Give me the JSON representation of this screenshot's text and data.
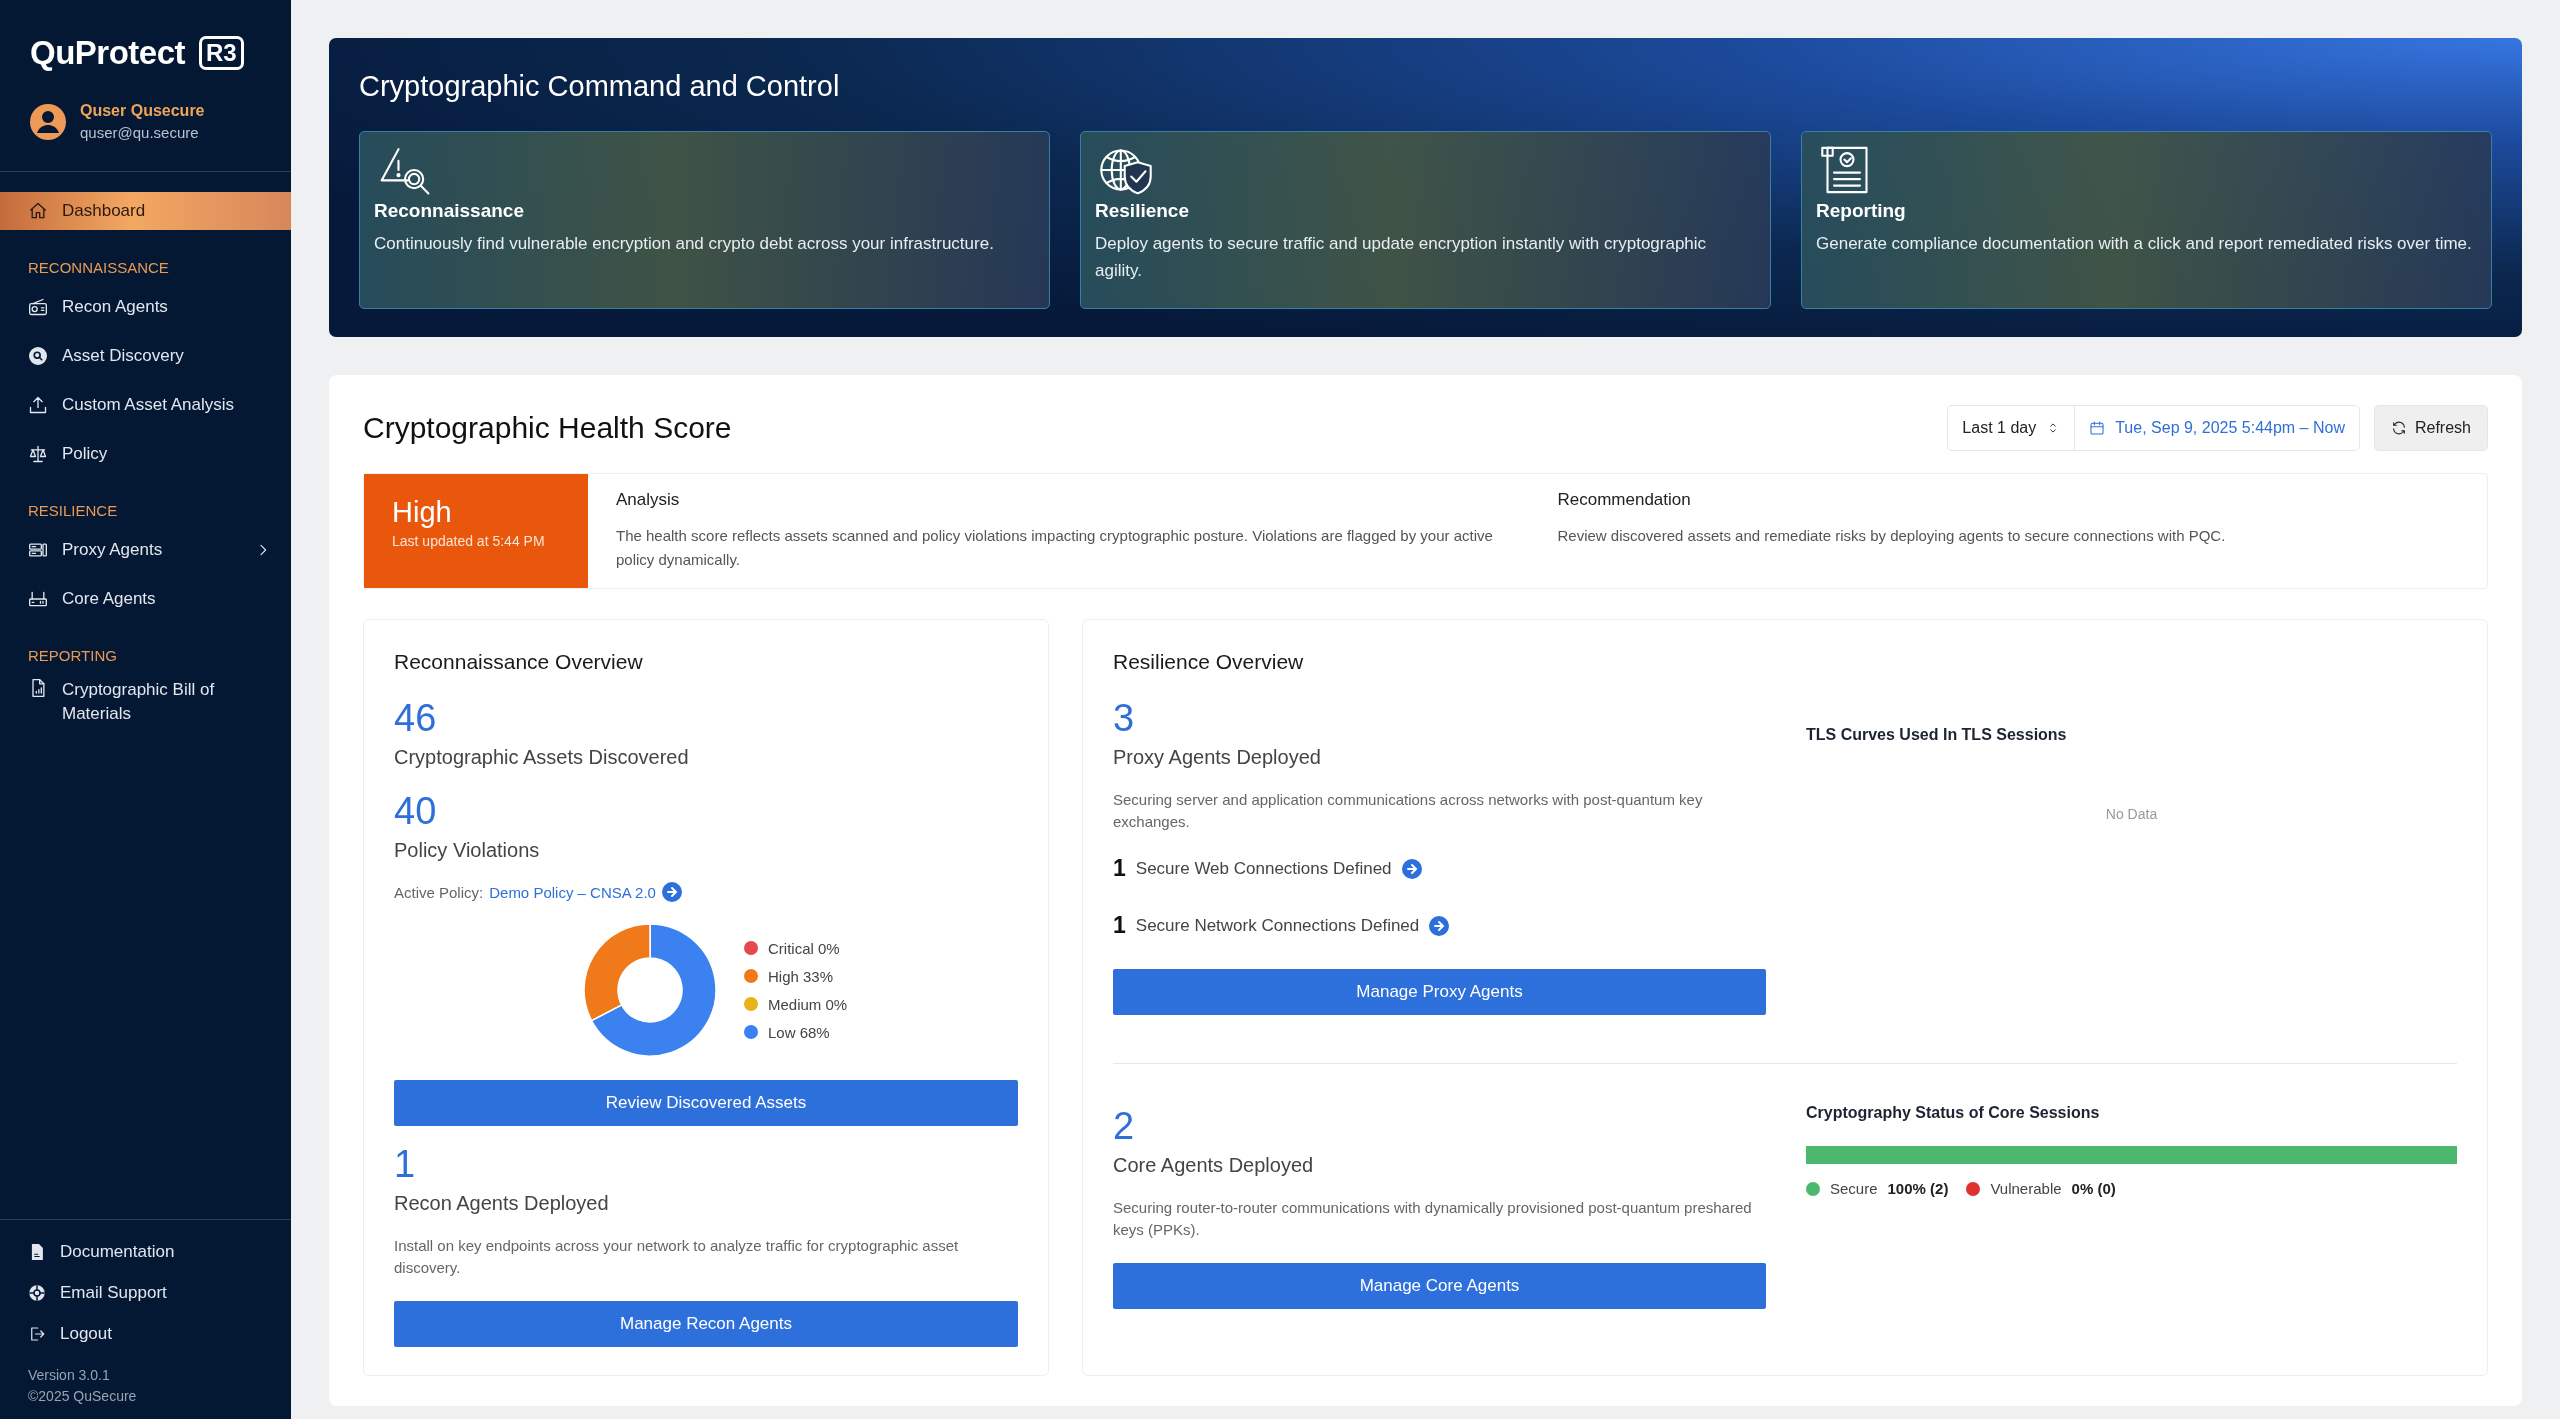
{
  "sidebar": {
    "logo": "QuProtect",
    "logo_mark": "R3",
    "user": {
      "name": "Quser Qusecure",
      "email": "quser@qu.secure"
    },
    "sections": [
      {
        "items": [
          {
            "label": "Dashboard",
            "selected": true,
            "has_submenu": false
          }
        ]
      },
      {
        "heading": "RECONNAISSANCE",
        "items": [
          {
            "label": "Recon Agents",
            "selected": false,
            "has_submenu": false
          },
          {
            "label": "Asset Discovery",
            "selected": false,
            "has_submenu": false
          },
          {
            "label": "Custom Asset Analysis",
            "selected": false,
            "has_submenu": false
          },
          {
            "label": "Policy",
            "selected": false,
            "has_submenu": false
          }
        ]
      },
      {
        "heading": "RESILIENCE",
        "items": [
          {
            "label": "Proxy Agents",
            "selected": false,
            "has_submenu": true
          },
          {
            "label": "Core Agents",
            "selected": false,
            "has_submenu": false
          }
        ]
      },
      {
        "heading": "REPORTING",
        "items": [
          {
            "label": "Cryptographic Bill of Materials",
            "selected": false,
            "has_submenu": false
          }
        ]
      }
    ],
    "footer_links": [
      "Documentation",
      "Email Support",
      "Logout"
    ],
    "version": "Version 3.0.1",
    "copyright": "©2025 QuSecure"
  },
  "banner": {
    "title": "Cryptographic Command and Control",
    "cards": [
      {
        "title": "Reconnaissance",
        "text": "Continuously find vulnerable encryption and crypto debt across your infrastructure."
      },
      {
        "title": "Resilience",
        "text": "Deploy agents to secure traffic and update encryption instantly with cryptographic agility."
      },
      {
        "title": "Reporting",
        "text": "Generate compliance documentation with a click and report remediated risks over time."
      }
    ]
  },
  "health": {
    "title": "Cryptographic Health Score",
    "range": "Last 1 day",
    "date_range": "Tue, Sep 9, 2025 5:44pm – Now",
    "refresh": "Refresh",
    "score": "High",
    "updated": "Last updated at 5:44 PM",
    "analysis": {
      "title": "Analysis",
      "text": "The health score reflects assets scanned and policy violations impacting cryptographic posture. Violations are flagged by your active policy dynamically."
    },
    "recommendation": {
      "title": "Recommendation",
      "text": "Review discovered assets and remediate risks by deploying agents to secure connections with PQC."
    }
  },
  "recon": {
    "title": "Reconnaissance Overview",
    "stats": [
      {
        "value": "46",
        "label": "Cryptographic Assets Discovered"
      },
      {
        "value": "40",
        "label": "Policy Violations"
      }
    ],
    "active_policy": {
      "label": "Active Policy:",
      "link": "Demo Policy – CNSA 2.0"
    },
    "chart_data": {
      "type": "donut",
      "categories": [
        "Critical",
        "High",
        "Medium",
        "Low"
      ],
      "values": [
        0,
        33,
        0,
        68
      ]
    },
    "legend": [
      {
        "percent": "0%",
        "color": "#e5484d"
      },
      {
        "percent": "33%",
        "color": "#f07a1a"
      },
      {
        "percent": "0%",
        "color": "#e8b21a"
      },
      {
        "percent": "68%",
        "color": "#3b82f0"
      }
    ],
    "review_button": "Review Discovered Assets",
    "agents": {
      "value": "1",
      "label": "Recon Agents Deployed",
      "text": "Install on key endpoints across your network to analyze traffic for cryptographic asset discovery."
    },
    "manage_button": "Manage Recon Agents"
  },
  "resilience": {
    "title": "Resilience Overview",
    "proxy": {
      "value": "3",
      "label": "Proxy Agents Deployed",
      "text": "Securing server and application communications across networks with post-quantum key exchanges.",
      "connections": [
        {
          "count": "1",
          "label": "Secure Web Connections Defined"
        },
        {
          "count": "1",
          "label": "Secure Network Connections Defined"
        }
      ],
      "button": "Manage Proxy Agents"
    },
    "tls": {
      "title": "TLS Curves Used In TLS Sessions",
      "empty": "No Data"
    },
    "core": {
      "value": "2",
      "label": "Core Agents Deployed",
      "text": "Securing router-to-router communications with dynamically provisioned post-quantum preshared keys (PPKs).",
      "button": "Manage Core Agents"
    },
    "core_status": {
      "title": "Cryptography Status of Core Sessions",
      "level": 1,
      "legend": [
        {
          "label": "Secure",
          "value": "100% (2)",
          "color": "#4cb86f"
        },
        {
          "label": "Vulnerable",
          "value": "0% (0)",
          "color": "#e03131"
        }
      ]
    }
  }
}
